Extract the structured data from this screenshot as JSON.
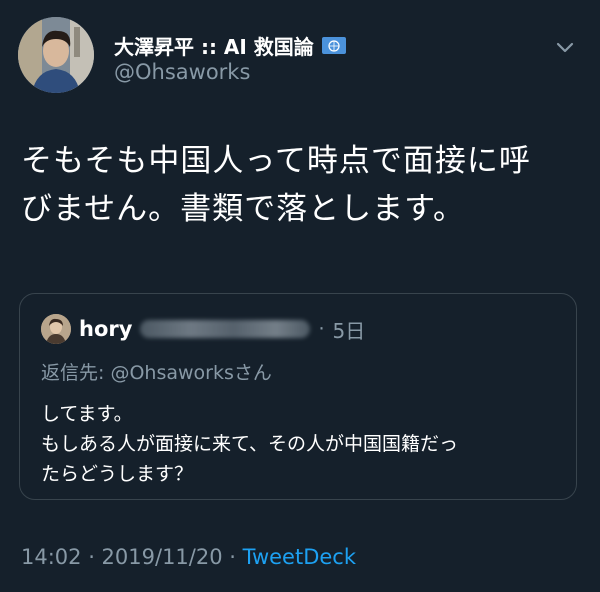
{
  "author": {
    "display_name": "大澤昇平 :: AI 救国論",
    "handle": "@Ohsaworks",
    "badge_icon": "un-flag-icon"
  },
  "tweet": {
    "text_line1": "そもそも中国人って時点で面接に呼",
    "text_line2": "びません。書類で落とします。",
    "timestamp": "14:02 · 2019/11/20 · ",
    "source": "TweetDeck"
  },
  "quoted": {
    "name": "hory",
    "separator": "·",
    "time": "5日",
    "reply_prefix": "返信先: ",
    "reply_handle": "@Ohsaworks",
    "reply_suffix": "さん",
    "line1": "してます。",
    "line2": "もしある人が面接に来て、その人が中国国籍だっ",
    "line3": "たらどうします？"
  },
  "colors": {
    "background": "#15202b",
    "secondary_text": "#8899a6",
    "link": "#1da1f2",
    "border": "#38444d"
  }
}
